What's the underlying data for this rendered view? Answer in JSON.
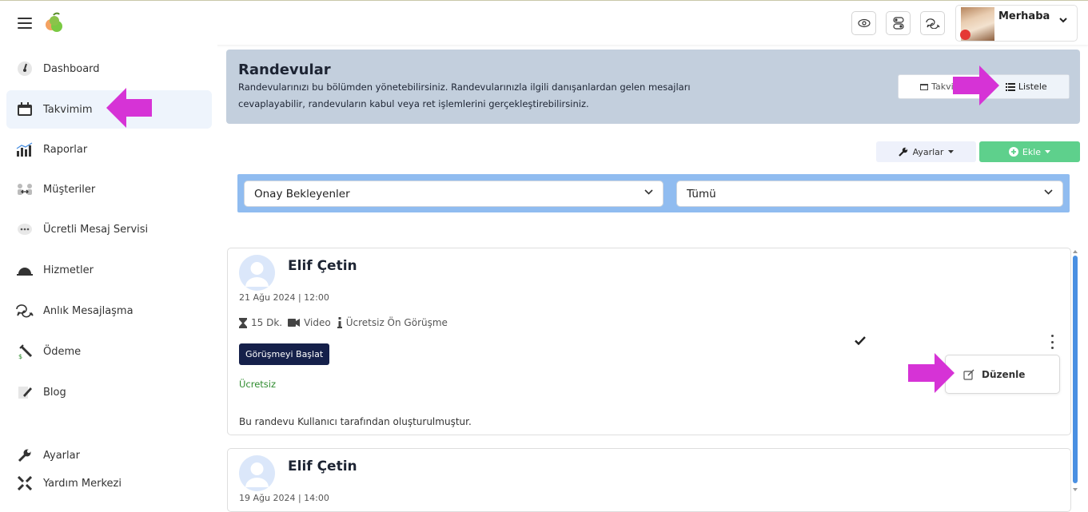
{
  "topbar": {
    "profile_name": "Merhaba"
  },
  "sidebar": {
    "items": [
      {
        "label": "Dashboard",
        "icon": "dashboard-icon"
      },
      {
        "label": "Takvimim",
        "icon": "calendar-icon",
        "active": true
      },
      {
        "label": "Raporlar",
        "icon": "chart-icon"
      },
      {
        "label": "Müşteriler",
        "icon": "customers-icon"
      },
      {
        "label": "Ücretli Mesaj Servisi",
        "icon": "message-dots-icon"
      },
      {
        "label": "Hizmetler",
        "icon": "services-icon"
      },
      {
        "label": "Anlık Mesajlaşma",
        "icon": "chat-icon"
      },
      {
        "label": "Ödeme",
        "icon": "payment-icon"
      },
      {
        "label": "Blog",
        "icon": "blog-icon"
      }
    ],
    "bottom_items": [
      {
        "label": "Ayarlar",
        "icon": "wrench-icon"
      },
      {
        "label": "Yardım Merkezi",
        "icon": "help-icon"
      }
    ]
  },
  "header": {
    "title": "Randevular",
    "description": "Randevularınızı bu bölümden yönetebilirsiniz. Randevularınızla ilgili danışanlardan gelen mesajları cevaplayabilir, randevuların kabul veya ret işlemlerini gerçekleştirebilirsiniz.",
    "view_calendar": "Takvim",
    "view_list": "Listele"
  },
  "actions": {
    "settings_label": "Ayarlar",
    "add_label": "Ekle"
  },
  "filters": {
    "status_value": "Onay Bekleyenler",
    "type_value": "Tümü"
  },
  "appointments": [
    {
      "name": "Elif Çetin",
      "date": "21 Ağu 2024 | 12:00",
      "duration": "15 Dk.",
      "mode": "Video",
      "service": "Ücretsiz Ön Görüşme",
      "start_label": "Görüşmeyi Başlat",
      "price": "Ücretsiz",
      "note": "Bu randevu Kullanıcı tarafından oluşturulmuştur.",
      "menu_edit": "Düzenle"
    },
    {
      "name": "Elif Çetin",
      "date": "19 Ağu 2024 | 14:00"
    }
  ],
  "colors": {
    "header_bg": "#c3cfdd",
    "filter_bg": "#90bcf0",
    "add_button": "#5ed08c",
    "start_button": "#15204a",
    "annotation_arrow": "#d633d6"
  }
}
